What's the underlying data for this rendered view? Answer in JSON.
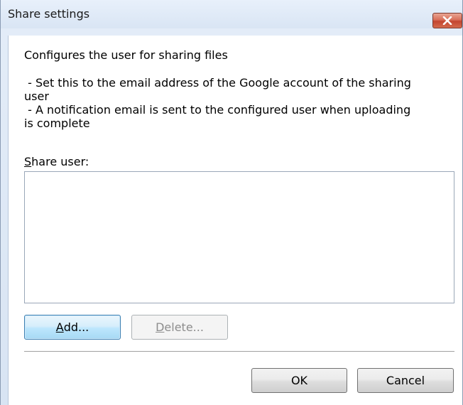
{
  "window": {
    "title": "Share settings",
    "close_label": "x"
  },
  "description": {
    "heading": "Configures the user for sharing files",
    "bullet1_line1": " - Set this to the email address of the Google account of the sharing",
    "bullet1_line2": "user",
    "bullet2_line1": " - A notification email is sent to the configured user when uploading",
    "bullet2_line2": "is complete"
  },
  "share_user": {
    "label_mnemonic": "S",
    "label_rest": "hare user:",
    "items": []
  },
  "buttons": {
    "add_mnemonic": "A",
    "add_rest": "dd...",
    "delete_mnemonic": "D",
    "delete_rest": "elete...",
    "ok": "OK",
    "cancel": "Cancel"
  },
  "colors": {
    "close_button": "#c34630",
    "default_button_border": "#3c7fb1",
    "window_frame": "#d8e4f3"
  }
}
